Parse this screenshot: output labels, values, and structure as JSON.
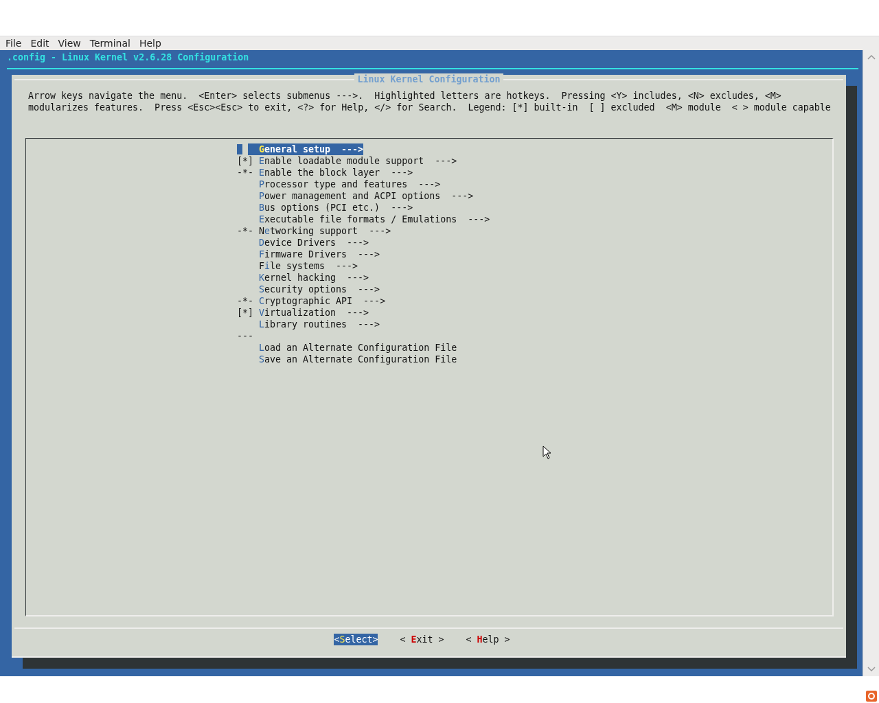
{
  "menubar": [
    "File",
    "Edit",
    "View",
    "Terminal",
    "Help"
  ],
  "terminal": {
    "title": ".config - Linux Kernel v2.6.28 Configuration"
  },
  "dialog": {
    "title": "Linux Kernel Configuration",
    "help_lines": [
      "Arrow keys navigate the menu.  <Enter> selects submenus --->.  Highlighted letters are hotkeys.  Pressing <Y> includes, <N> excludes, <M>",
      "modularizes features.  Press <Esc><Esc> to exit, <?> for Help, </> for Search.  Legend: [*] built-in  [ ] excluded  <M> module  < > module capable"
    ],
    "items": [
      {
        "label": "**G**eneral setup  --->",
        "selected": true
      },
      {
        "prefix": "[*]",
        "label": "**E**nable loadable module support  --->",
        "selected": false
      },
      {
        "prefix": "-*-",
        "label": "**E**nable the block layer  --->",
        "selected": false
      },
      {
        "label": "**P**rocessor type and features  --->",
        "selected": false
      },
      {
        "label": "**P**ower management and ACPI options  --->",
        "selected": false
      },
      {
        "label": "**B**us options (PCI etc.)  --->",
        "selected": false
      },
      {
        "label": "**E**xecutable file formats / Emulations  --->",
        "selected": false
      },
      {
        "prefix": "-*-",
        "label": "N**e**tworking support  --->",
        "selected": false
      },
      {
        "label": "**D**evice Drivers  --->",
        "selected": false
      },
      {
        "label": "**F**irmware Drivers  --->",
        "selected": false
      },
      {
        "label": "F**i**le systems  --->",
        "selected": false
      },
      {
        "label": "**K**ernel hacking  --->",
        "selected": false
      },
      {
        "label": "**S**ecurity options  --->",
        "selected": false
      },
      {
        "prefix": "-*-",
        "label": "**C**ryptographic API  --->",
        "selected": false
      },
      {
        "prefix": "[*]",
        "label": "**V**irtualization  --->",
        "selected": false
      },
      {
        "label": "**L**ibrary routines  --->",
        "selected": false
      },
      {
        "prefix": "---",
        "selected": false
      },
      {
        "label": "**L**oad an Alternate Configuration File",
        "selected": false
      },
      {
        "label": "**S**ave an Alternate Configuration File",
        "selected": false
      }
    ],
    "buttons": [
      {
        "label": "<**S**elect>",
        "selected": true
      },
      {
        "label": "< **E**xit >",
        "selected": false
      },
      {
        "label": "< **H**elp >",
        "selected": false
      }
    ]
  }
}
